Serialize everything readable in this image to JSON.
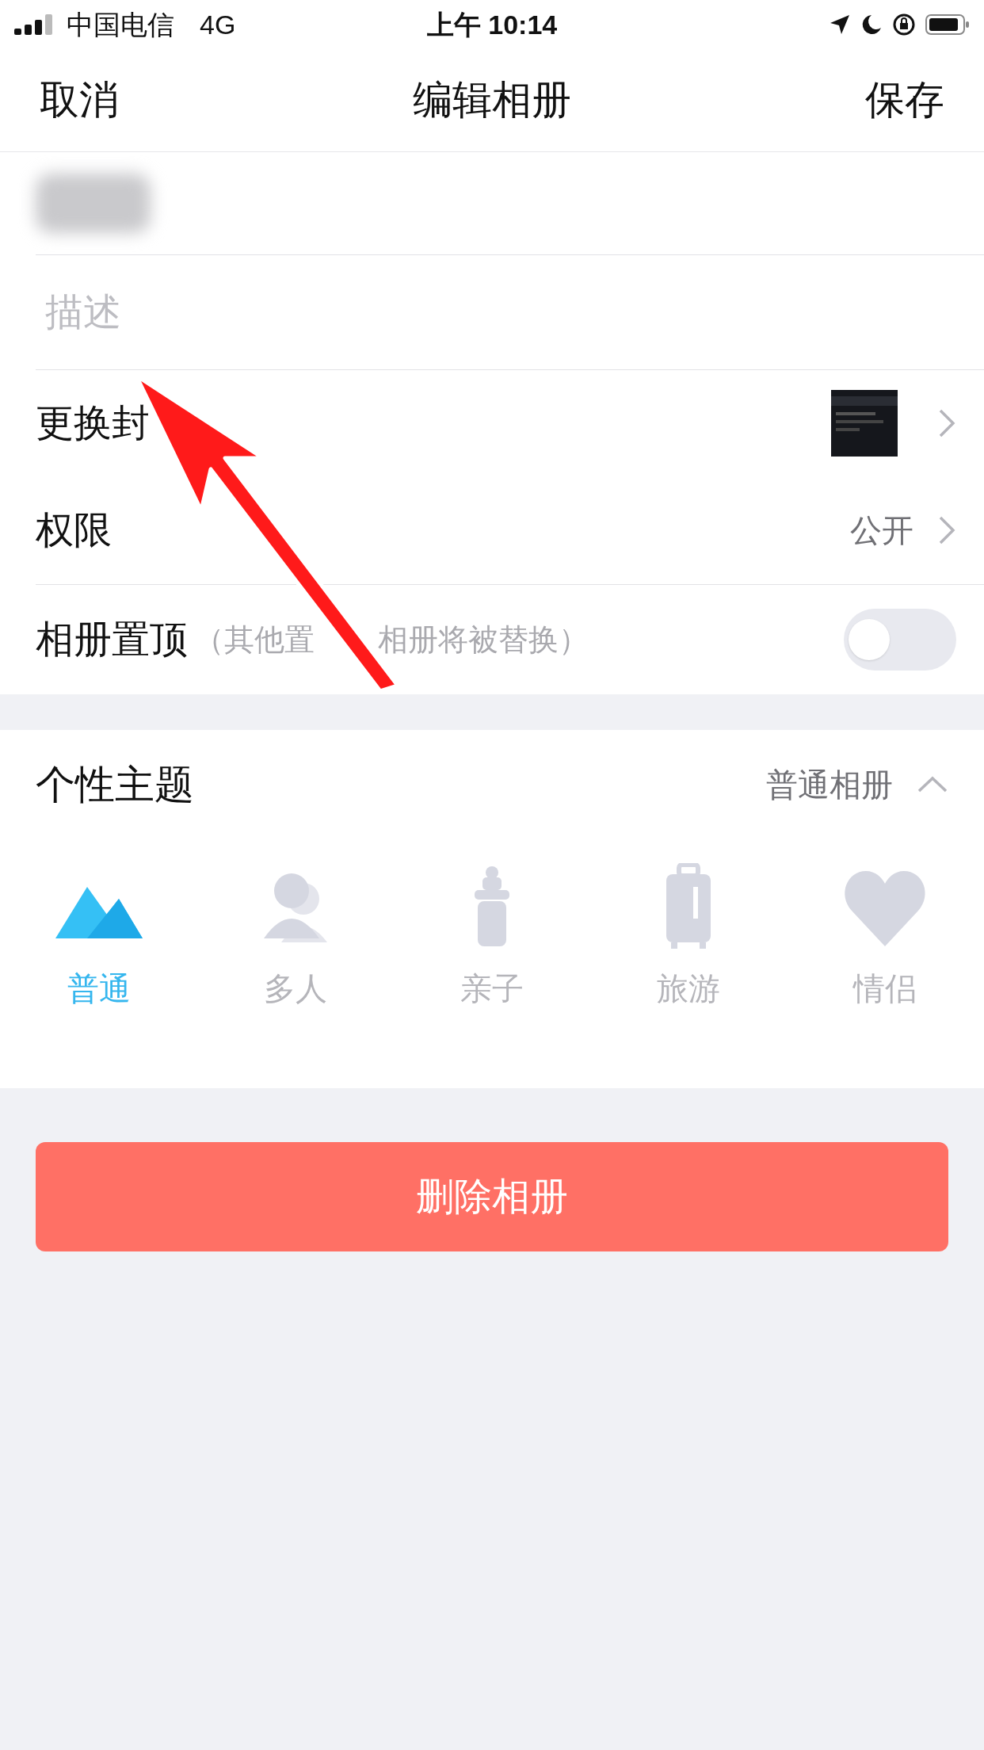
{
  "status_bar": {
    "carrier": "中国电信",
    "network": "4G",
    "time": "上午 10:14"
  },
  "nav": {
    "cancel": "取消",
    "title": "编辑相册",
    "save": "保存"
  },
  "form": {
    "description_placeholder": "描述",
    "rows": [
      {
        "kind": "cover",
        "label": "更换封"
      },
      {
        "kind": "value",
        "label": "权限",
        "value": "公开"
      },
      {
        "kind": "toggle",
        "label": "相册置顶",
        "hint": [
          "（其他置",
          "相册将被替换）"
        ],
        "on": false
      }
    ]
  },
  "theme": {
    "title": "个性主题",
    "value": "普通相册",
    "expanded": true,
    "options": [
      {
        "kind": "mountain",
        "label": "普通",
        "selected": true
      },
      {
        "kind": "people",
        "label": "多人",
        "selected": false
      },
      {
        "kind": "bottle",
        "label": "亲子",
        "selected": false
      },
      {
        "kind": "luggage",
        "label": "旅游",
        "selected": false
      },
      {
        "kind": "heart",
        "label": "情侣",
        "selected": false
      }
    ]
  },
  "delete_button": "删除相册"
}
